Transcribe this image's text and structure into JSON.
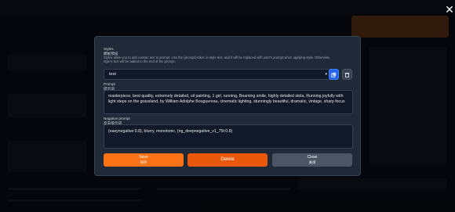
{
  "close_icon_glyph": "✕",
  "styles": {
    "title": "Styles",
    "title_cn": "模板预设",
    "description": "Styles allow you to add custom text to prompt. Use the {prompt} token in style text, and it will be replaced with user's prompt when applying style. Otherwise, style's text will be added to the end of the prompt.",
    "selected": "test",
    "chevron": "▾"
  },
  "prompt": {
    "label": "Prompt",
    "label_cn": "提示词",
    "value": "masterpiece, best quality, extremely detailed, oil painting, 1 girl, running, Beaming smile, highly detailed stola, Running joyfully with light steps on the grassland, by William Adolphe Bouguereau, cinematic lighting, stunningly beautiful, dramatic, vintage, sharp focus"
  },
  "negative_prompt": {
    "label": "Negative prompt",
    "label_cn": "反向提示词",
    "value": "(easynegative:0.8), blurry, monotonic, (ng_deepnegative_v1_75t:0.8)"
  },
  "buttons": {
    "save": "Save",
    "save_cn": "保存",
    "delete": "Delete",
    "close": "Close",
    "close_cn": "关闭"
  },
  "colors": {
    "accent": "#f97316",
    "delete": "#ea580c",
    "copy_button": "#2563eb",
    "modal_bg": "#1f2937"
  }
}
